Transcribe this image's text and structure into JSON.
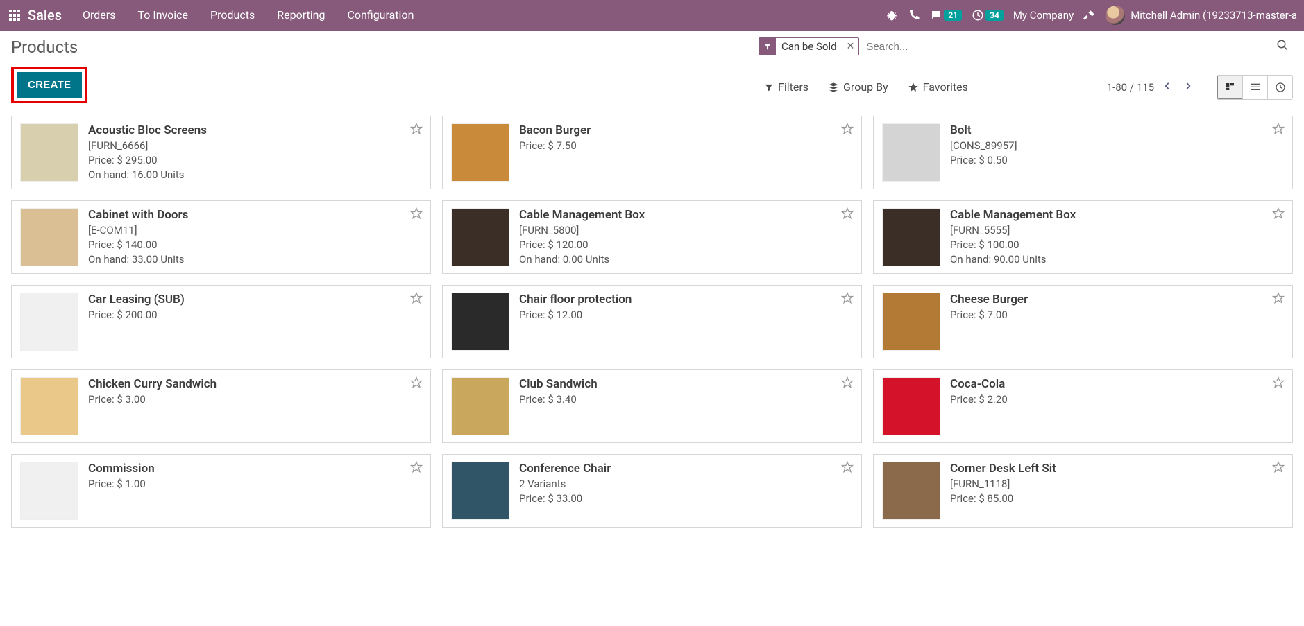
{
  "brand": "Sales",
  "nav": [
    "Orders",
    "To Invoice",
    "Products",
    "Reporting",
    "Configuration"
  ],
  "systray": {
    "chat_badge": "21",
    "clock_badge": "34",
    "company": "My Company",
    "user": "Mitchell Admin (19233713-master-a"
  },
  "breadcrumb": "Products",
  "search": {
    "facet": "Can be Sold",
    "placeholder": "Search..."
  },
  "create_btn": "CREATE",
  "tools": {
    "filters": "Filters",
    "groupby": "Group By",
    "favorites": "Favorites"
  },
  "pager": {
    "range": "1-80 / 115"
  },
  "price_label": "Price: ",
  "onhand_label": "On hand: ",
  "variants_suffix": " Variants",
  "products": [
    {
      "name": "Acoustic Bloc Screens",
      "sku": "[FURN_6666]",
      "price": "$ 295.00",
      "onhand": "16.00 Units",
      "thumb": "#d7cfae"
    },
    {
      "name": "Bacon Burger",
      "sku": "",
      "price": "$ 7.50",
      "onhand": "",
      "thumb": "#c98a3a"
    },
    {
      "name": "Bolt",
      "sku": "[CONS_89957]",
      "price": "$ 0.50",
      "onhand": "",
      "thumb": "#d4d4d4"
    },
    {
      "name": "Cabinet with Doors",
      "sku": "[E-COM11]",
      "price": "$ 140.00",
      "onhand": "33.00 Units",
      "thumb": "#d9bf93"
    },
    {
      "name": "Cable Management Box",
      "sku": "[FURN_5800]",
      "price": "$ 120.00",
      "onhand": "0.00 Units",
      "thumb": "#3a2e26"
    },
    {
      "name": "Cable Management Box",
      "sku": "[FURN_5555]",
      "price": "$ 100.00",
      "onhand": "90.00 Units",
      "thumb": "#3a2e26"
    },
    {
      "name": "Car Leasing (SUB)",
      "sku": "",
      "price": "$ 200.00",
      "onhand": "",
      "thumb": "#f0f0f0"
    },
    {
      "name": "Chair floor protection",
      "sku": "",
      "price": "$ 12.00",
      "onhand": "",
      "thumb": "#2a2a2a"
    },
    {
      "name": "Cheese Burger",
      "sku": "",
      "price": "$ 7.00",
      "onhand": "",
      "thumb": "#b37a36"
    },
    {
      "name": "Chicken Curry Sandwich",
      "sku": "",
      "price": "$ 3.00",
      "onhand": "",
      "thumb": "#e9c88a"
    },
    {
      "name": "Club Sandwich",
      "sku": "",
      "price": "$ 3.40",
      "onhand": "",
      "thumb": "#c9a85e"
    },
    {
      "name": "Coca-Cola",
      "sku": "",
      "price": "$ 2.20",
      "onhand": "",
      "thumb": "#d4122a"
    },
    {
      "name": "Commission",
      "sku": "",
      "price": "$ 1.00",
      "onhand": "",
      "thumb": "#f0f0f0"
    },
    {
      "name": "Conference Chair",
      "sku": "",
      "price": "$ 33.00",
      "onhand": "",
      "thumb": "#2f5566",
      "variants": "2"
    },
    {
      "name": "Corner Desk Left Sit",
      "sku": "[FURN_1118]",
      "price": "$ 85.00",
      "onhand": "",
      "thumb": "#8a6a4a"
    }
  ]
}
